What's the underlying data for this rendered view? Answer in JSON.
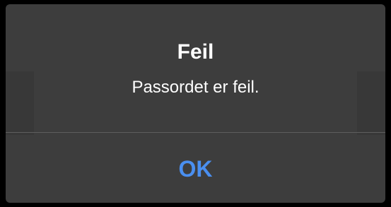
{
  "dialog": {
    "title": "Feil",
    "message": "Passordet er feil.",
    "ok_label": "OK"
  },
  "colors": {
    "frame": "#000000",
    "dialog_background": "#3d3d3d",
    "divider": "#5e5e5e",
    "text": "#ffffff",
    "button_accent": "#4a8ff0"
  }
}
